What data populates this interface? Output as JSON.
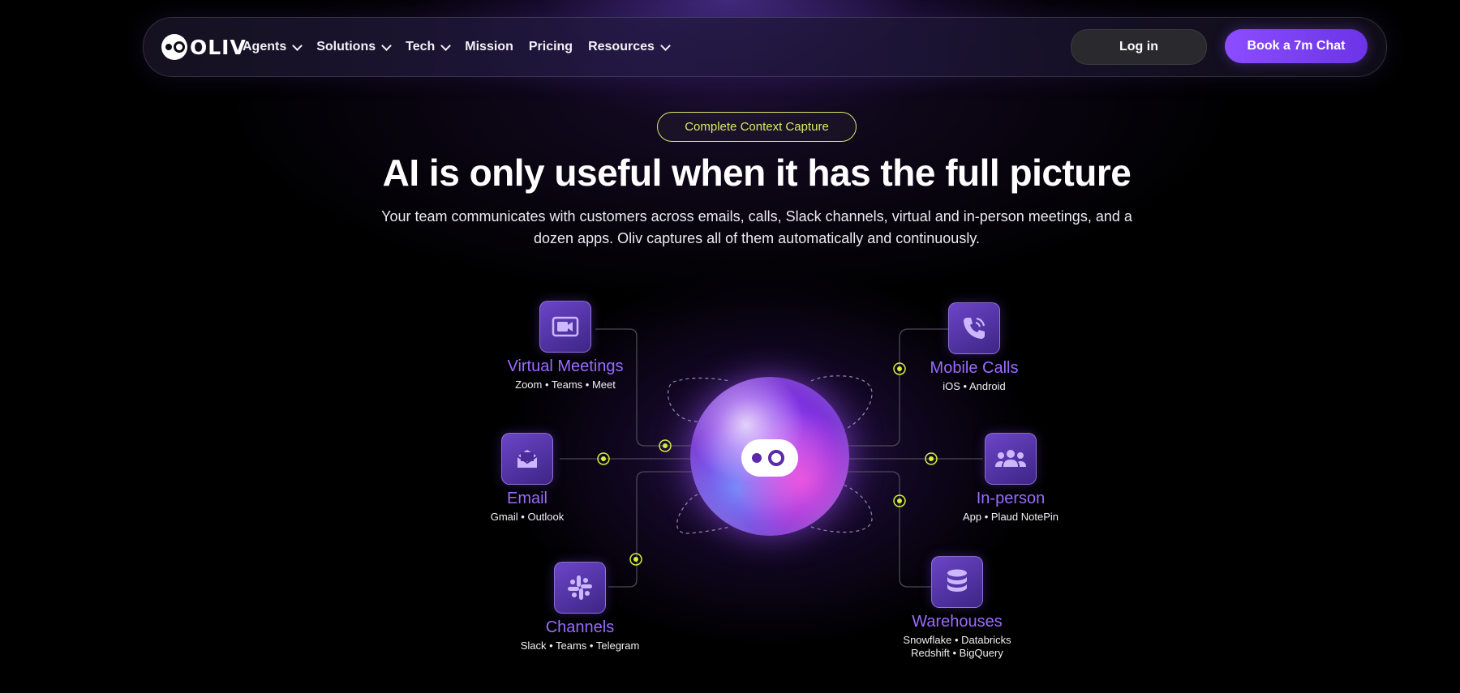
{
  "brand": {
    "name": "OLIV"
  },
  "nav": {
    "items": [
      {
        "label": "Agents",
        "has_dropdown": true
      },
      {
        "label": "Solutions",
        "has_dropdown": true
      },
      {
        "label": "Tech",
        "has_dropdown": true
      },
      {
        "label": "Mission",
        "has_dropdown": false
      },
      {
        "label": "Pricing",
        "has_dropdown": false
      },
      {
        "label": "Resources",
        "has_dropdown": true
      }
    ],
    "login_label": "Log in",
    "cta_label": "Book a 7m Chat"
  },
  "hero": {
    "badge": "Complete Context Capture",
    "headline": "AI is only useful when it has the full picture",
    "subtext": "Your team communicates with customers across emails, calls, Slack channels, virtual and in-person meetings, and a dozen apps. Oliv captures all of them automatically and continuously."
  },
  "sources": [
    {
      "title": "Virtual Meetings",
      "subtitle": "Zoom • Teams • Meet",
      "icon": "video-camera-icon"
    },
    {
      "title": "Email",
      "subtitle": "Gmail • Outlook",
      "icon": "mail-icon"
    },
    {
      "title": "Channels",
      "subtitle": "Slack • Teams • Telegram",
      "icon": "slack-icon"
    },
    {
      "title": "Mobile Calls",
      "subtitle": "iOS • Android",
      "icon": "phone-icon"
    },
    {
      "title": "In-person",
      "subtitle": "App • Plaud NotePin",
      "icon": "users-icon"
    },
    {
      "title": "Warehouses",
      "subtitle": "Snowflake • Databricks",
      "subtitle2": "Redshift • BigQuery",
      "icon": "database-icon"
    }
  ],
  "colors": {
    "accent_purple": "#8b4dff",
    "title_purple": "#9a6bff",
    "badge_lime": "#d6ea6a",
    "connector_lime": "#d4f03a",
    "background": "#000000"
  }
}
